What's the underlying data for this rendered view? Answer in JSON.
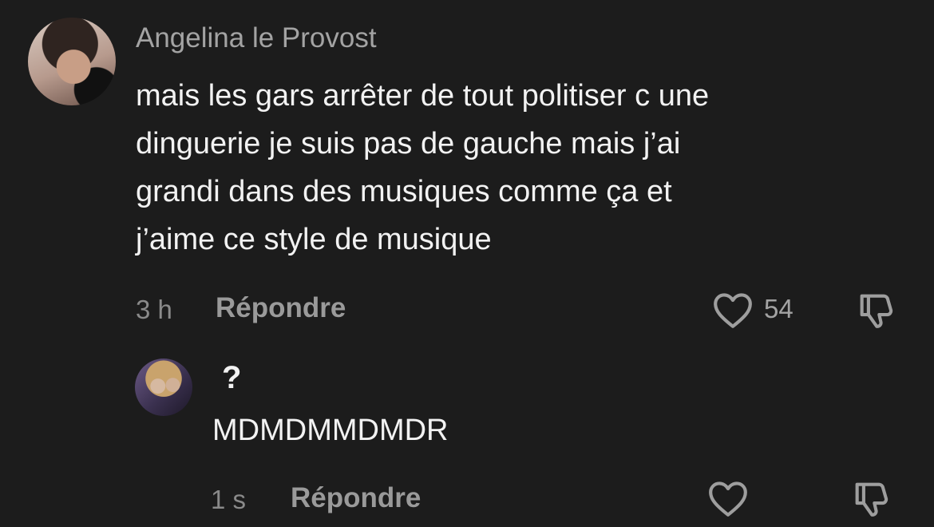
{
  "comment": {
    "username": "Angelina le Provost",
    "text_lines": [
      "mais les gars arrêter de tout politiser c une",
      "dinguerie je suis pas de gauche mais j’ai",
      "grandi dans des musiques comme ça et",
      "j’aime ce style de musique"
    ],
    "time": "3 h",
    "reply_label": "Répondre",
    "like_count": "54"
  },
  "reply": {
    "username": "?",
    "text": "MDMDMMDMDR",
    "time": "1 s",
    "reply_label": "Répondre"
  },
  "icons": {
    "like": "heart-outline-icon",
    "dislike": "thumbs-down-icon"
  },
  "colors": {
    "background": "#1c1c1c",
    "primary_text": "#f2f2f2",
    "secondary_text": "#a3a3a3"
  }
}
